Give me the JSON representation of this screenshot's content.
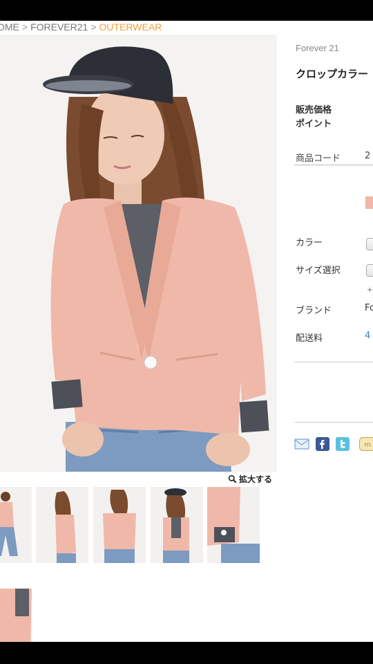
{
  "breadcrumb": {
    "home": "OME",
    "sep": ">",
    "brand": "FOREVER21",
    "current": "OUTERWEAR"
  },
  "product": {
    "brand": "Forever 21",
    "title": "クロップカラー",
    "price_label": "販売価格",
    "point_label": "ポイント",
    "code_label": "商品コード",
    "code_value": "2",
    "color_label": "カラー",
    "size_label": "サイズ選択",
    "size_plus": "+",
    "brand_label": "ブランド",
    "brand_value": "Fo",
    "shipping_label": "配送料",
    "shipping_value": "4"
  },
  "zoom": {
    "label": "拡大する",
    "icon": "magnifier-icon"
  },
  "colors": {
    "accent_orange": "#f0a040",
    "swatch": "#f2b7a8",
    "link_blue": "#3a7bd5",
    "jacket": "#f0b8a8"
  },
  "share_icons": [
    "mail-icon",
    "facebook-icon",
    "twitter-icon",
    "mixi-icon"
  ],
  "thumbnails": [
    "full-body-front",
    "side-view",
    "back-view",
    "front-with-cap",
    "sleeve-detail",
    "front-closeup"
  ]
}
